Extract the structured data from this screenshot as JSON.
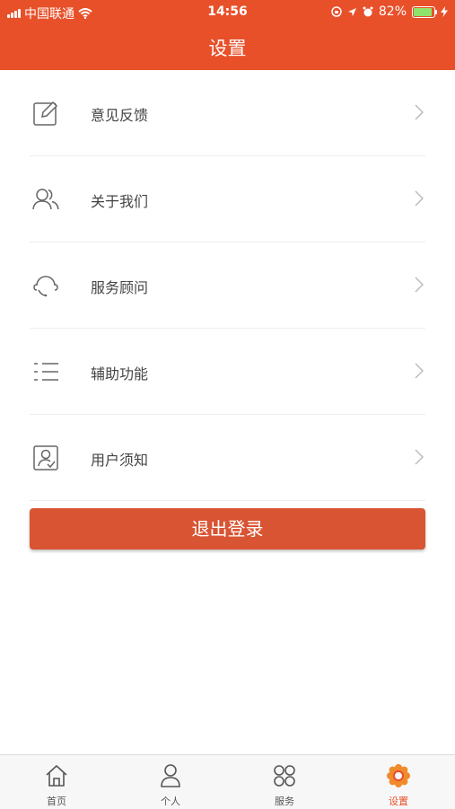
{
  "status_bar": {
    "carrier": "中国联通",
    "time": "14:56",
    "battery": "82%"
  },
  "header": {
    "title": "设置"
  },
  "menu": {
    "items": [
      {
        "label": "意见反馈",
        "icon": "edit-icon"
      },
      {
        "label": "关于我们",
        "icon": "users-icon"
      },
      {
        "label": "服务顾问",
        "icon": "headset-icon"
      },
      {
        "label": "辅助功能",
        "icon": "list-icon"
      },
      {
        "label": "用户须知",
        "icon": "user-card-icon"
      }
    ]
  },
  "logout": {
    "label": "退出登录"
  },
  "tabbar": {
    "items": [
      {
        "label": "首页",
        "icon": "home-icon"
      },
      {
        "label": "个人",
        "icon": "person-icon"
      },
      {
        "label": "服务",
        "icon": "grid-icon"
      },
      {
        "label": "设置",
        "icon": "gear-icon",
        "active": true
      }
    ]
  },
  "colors": {
    "accent": "#e8502a",
    "button": "#d85433"
  }
}
